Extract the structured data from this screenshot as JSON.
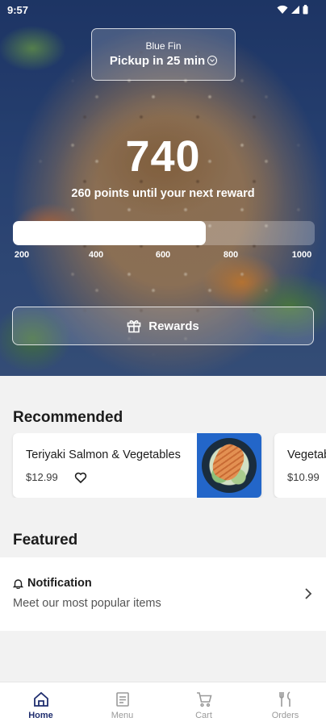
{
  "status_bar": {
    "time": "9:57"
  },
  "pickup": {
    "store": "Blue Fin",
    "time_text": "Pickup in 25 min"
  },
  "points": {
    "value": "740",
    "caption": "260 points until your next reward",
    "progress_fraction": 0.64,
    "ticks": [
      "200",
      "400",
      "600",
      "800",
      "1000"
    ]
  },
  "rewards_button": {
    "label": "Rewards",
    "icon": "gift-icon"
  },
  "recommended": {
    "title": "Recommended",
    "items": [
      {
        "name": "Teriyaki Salmon & Vegetables",
        "price": "$12.99",
        "icon": "heart-icon"
      },
      {
        "name": "Vegetable Bowl",
        "price": "$10.99"
      }
    ]
  },
  "featured": {
    "title": "Featured",
    "card": {
      "title": "Notification",
      "subtitle": "Meet our most popular items",
      "icon": "bell-icon"
    }
  },
  "bottom_nav": {
    "items": [
      {
        "label": "Home",
        "icon": "home-icon",
        "active": true
      },
      {
        "label": "Menu",
        "icon": "menu-icon",
        "active": false
      },
      {
        "label": "Cart",
        "icon": "cart-icon",
        "active": false
      },
      {
        "label": "Orders",
        "icon": "orders-icon",
        "active": false
      }
    ]
  },
  "colors": {
    "nav_active": "#1f2d6e",
    "nav_inactive": "#9a9a9a",
    "hero_blue": "#1f3d78"
  }
}
